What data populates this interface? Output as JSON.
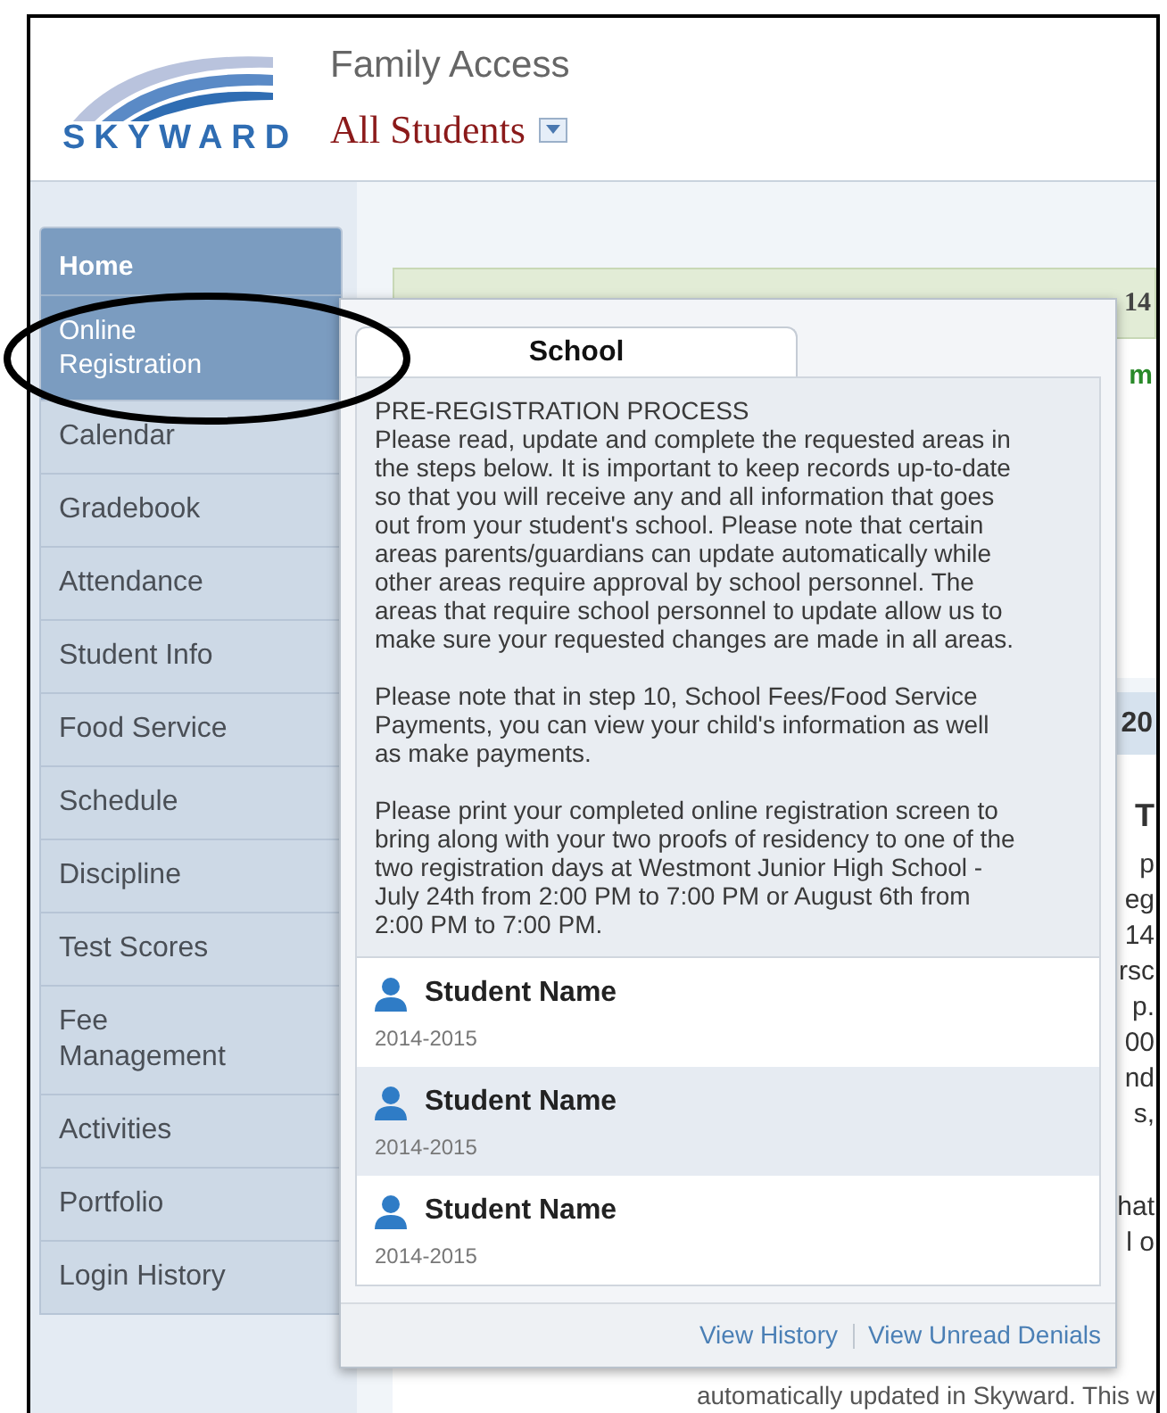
{
  "header": {
    "logo_text": "SKYWARD",
    "app_title": "Family Access",
    "student_selector": "All Students"
  },
  "sidebar": {
    "items": [
      {
        "label": "Home",
        "kind": "header"
      },
      {
        "label": "Online Registration",
        "kind": "item",
        "selected": true
      },
      {
        "label": "Calendar",
        "kind": "item",
        "selected": false
      },
      {
        "label": "Gradebook",
        "kind": "item",
        "selected": false
      },
      {
        "label": "Attendance",
        "kind": "item",
        "selected": false
      },
      {
        "label": "Student Info",
        "kind": "item",
        "selected": false
      },
      {
        "label": "Food Service",
        "kind": "item",
        "selected": false
      },
      {
        "label": "Schedule",
        "kind": "item",
        "selected": false
      },
      {
        "label": "Discipline",
        "kind": "item",
        "selected": false
      },
      {
        "label": "Test Scores",
        "kind": "item",
        "selected": false
      },
      {
        "label": "Fee Management",
        "kind": "item",
        "selected": false
      },
      {
        "label": "Activities",
        "kind": "item",
        "selected": false
      },
      {
        "label": "Portfolio",
        "kind": "item",
        "selected": false
      },
      {
        "label": "Login History",
        "kind": "item",
        "selected": false
      }
    ]
  },
  "background": {
    "notice_text": "14",
    "notice_sub": "m",
    "section_header": "20",
    "lines": [
      "T",
      "p",
      "eg",
      "14",
      "rsc",
      "p.",
      "00",
      "nd",
      "s,",
      "hat",
      "l o"
    ],
    "bottom_line": "automatically updated in Skyward.  This w"
  },
  "popup": {
    "tab": "School",
    "title": "PRE-REGISTRATION PROCESS",
    "paragraphs": [
      "Please read, update and complete the requested areas in the steps below. It is important to keep records up-to-date so that you will receive any and all information that goes out from your student's school. Please note that certain areas parents/guardians can update automatically while other areas require approval by school personnel. The areas that require school personnel to update allow us to make sure your requested changes are made in all areas.",
      "Please note that in step 10, School Fees/Food Service Payments, you can view your child's information as well as make payments.",
      "Please print your completed online registration screen to bring along with your two proofs of residency to one of the two registration days at Westmont Junior High School - July 24th from 2:00 PM to 7:00 PM or August 6th from 2:00 PM to 7:00 PM."
    ],
    "students": [
      {
        "name": "Student Name",
        "year": "2014-2015",
        "selected": false
      },
      {
        "name": "Student Name",
        "year": "2014-2015",
        "selected": true
      },
      {
        "name": "Student Name",
        "year": "2014-2015",
        "selected": false
      }
    ],
    "footer_links": [
      "View History",
      "View Unread Denials"
    ]
  }
}
